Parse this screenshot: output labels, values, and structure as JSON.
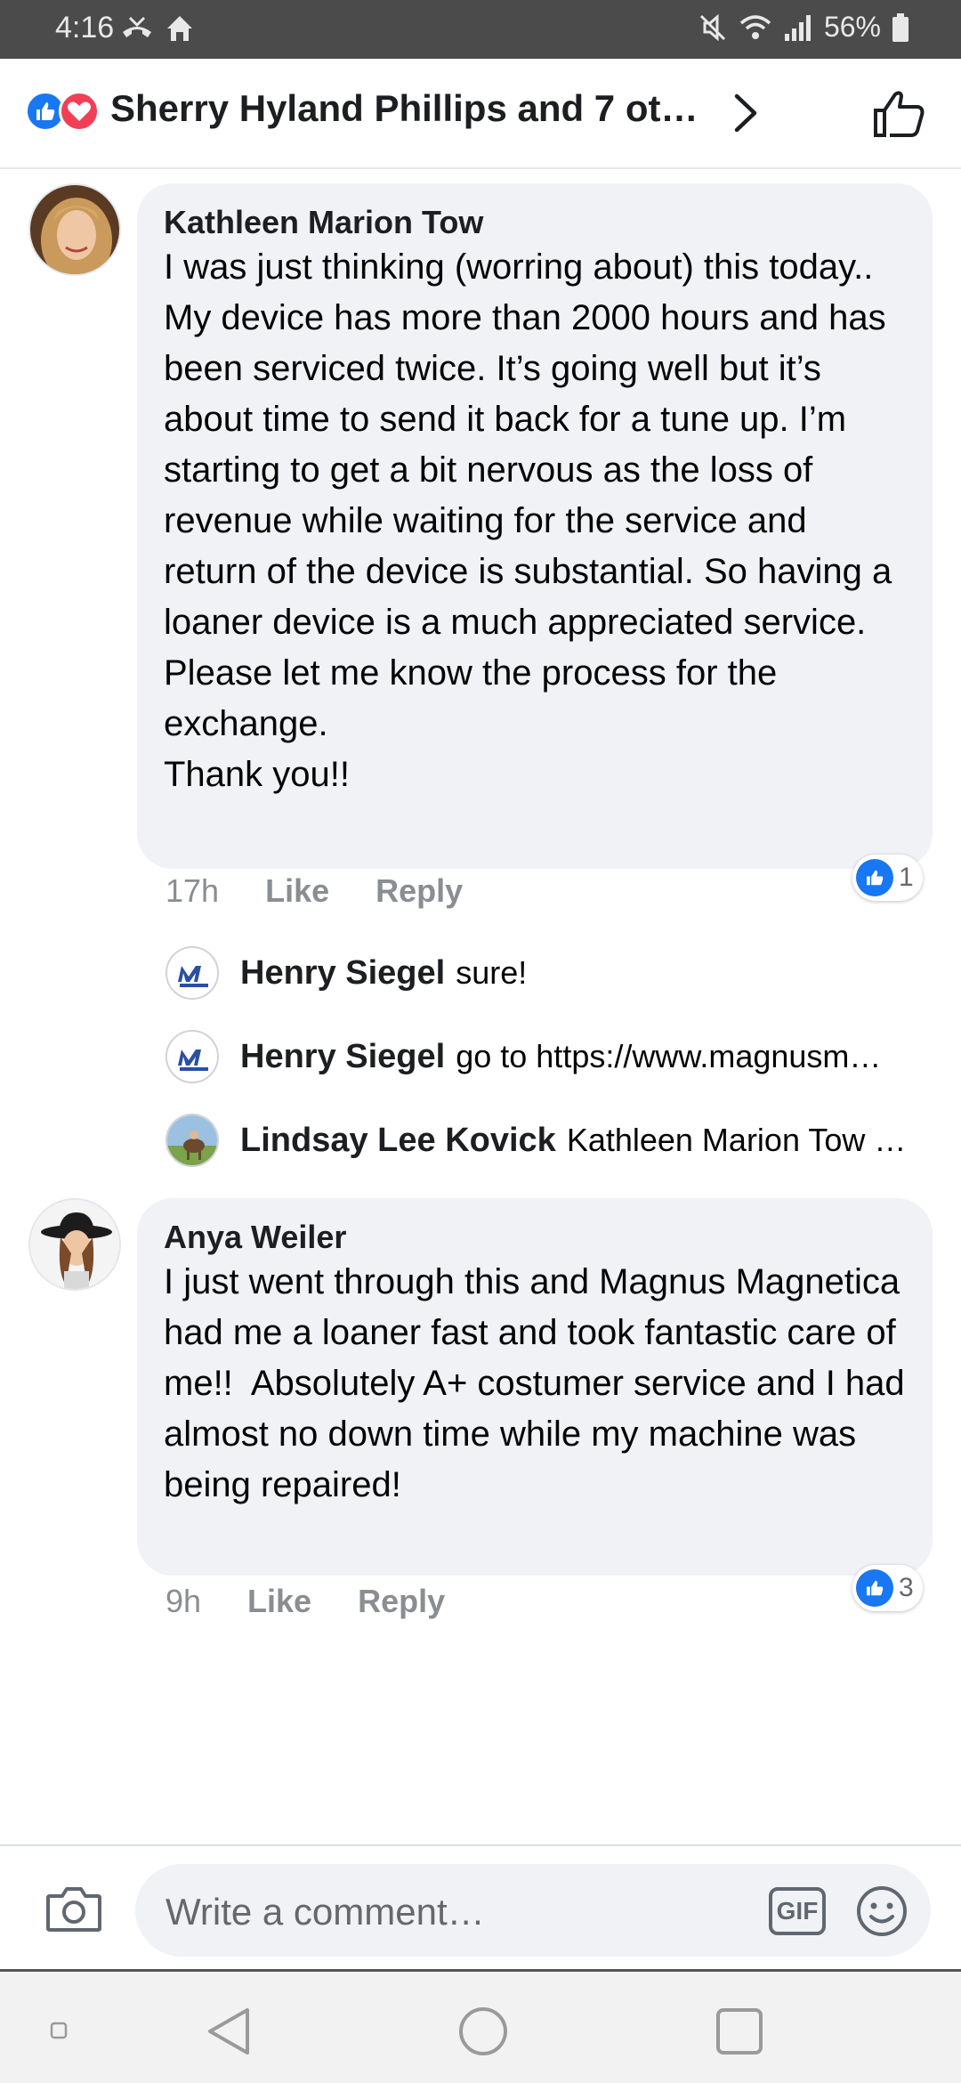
{
  "status_bar": {
    "time": "4:16",
    "battery": "56%"
  },
  "header": {
    "title": "Sherry Hyland Phillips and 7 ot…"
  },
  "comments": [
    {
      "author": "Kathleen Marion Tow",
      "text": "I was just thinking (worring about) this today.. My device has more than 2000 hours and has been serviced twice. It’s going well but it’s about time to send it back for a tune up. I’m starting to get a bit nervous as the loss of revenue while waiting for the service and return of the device is substantial. So having a loaner device is a much appreciated service. Please let me know the process for the exchange.\nThank you!!",
      "time": "17h",
      "like_label": "Like",
      "reply_label": "Reply",
      "reaction_count": "1",
      "replies": [
        {
          "author": "Henry Siegel",
          "text": "sure!"
        },
        {
          "author": "Henry Siegel",
          "text": "go to https://www.magnusm…"
        },
        {
          "author": "Lindsay Lee Kovick",
          "text": "Kathleen Marion Tow …"
        }
      ]
    },
    {
      "author": "Anya Weiler",
      "text": "I just went through this and Magnus Magnetica had me a loaner fast and took fantastic care of me!!  Absolutely A+ costumer service and I had almost no down time while my machine was being repaired!",
      "time": "9h",
      "like_label": "Like",
      "reply_label": "Reply",
      "reaction_count": "3"
    }
  ],
  "composer": {
    "placeholder": "Write a comment…",
    "gif_label": "GIF"
  },
  "icons": {
    "reactions": [
      "like-icon",
      "love-icon"
    ],
    "header": [
      "chevron-right-icon",
      "thumbs-up-icon"
    ],
    "composer": [
      "camera-icon",
      "gif-icon",
      "emoji-icon"
    ],
    "nav": [
      "nav-back-icon",
      "nav-home-icon",
      "nav-recents-icon"
    ]
  },
  "colors": {
    "like_blue": "#1877f2",
    "love_red": "#f33e58",
    "bubble": "#f0f2f5",
    "meta_gray": "#8a8d91"
  }
}
